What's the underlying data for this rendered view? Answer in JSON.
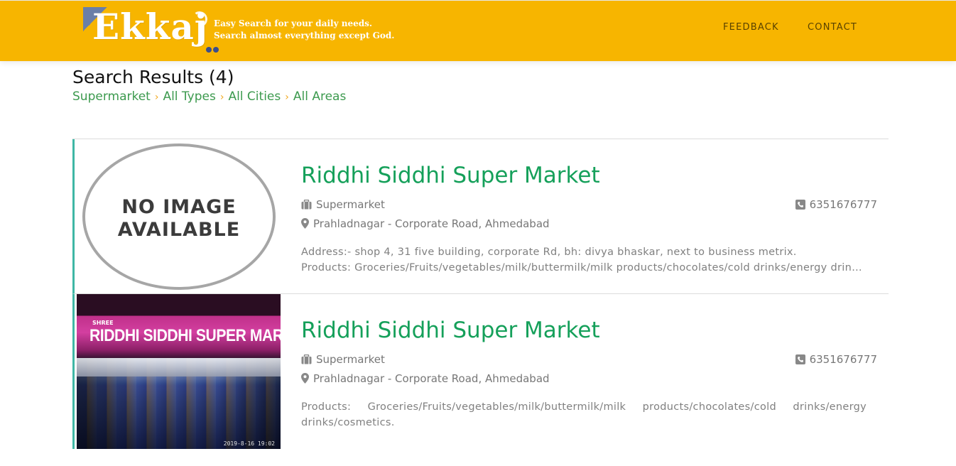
{
  "header": {
    "logo_text": "Ekkaj",
    "tagline_line1": "Easy Search for your daily needs.",
    "tagline_line2": "Search almost everything except God.",
    "nav": [
      {
        "label": "FEEDBACK"
      },
      {
        "label": "CONTACT"
      }
    ],
    "colors": {
      "header_bg": "#f7b500",
      "accent_green": "#15a05a",
      "breadcrumb_green": "#3c9a4e",
      "card_border": "#3fb7a5"
    }
  },
  "results": {
    "title": "Search Results (4)",
    "breadcrumb": [
      "Supermarket",
      "All Types",
      "All Cities",
      "All Areas"
    ]
  },
  "listings": [
    {
      "name": "Riddhi Siddhi Super Market",
      "category": "Supermarket",
      "phone": "6351676777",
      "location": "Prahladnagar - Corporate Road, Ahmedabad",
      "description_line1": "Address:- shop 4, 31 five building, corporate Rd, bh: divya bhaskar, next to business metrix.",
      "description_line2": "Products: Groceries/Fruits/vegetables/milk/buttermilk/milk products/chocolates/cold drinks/energy drinks/cosmetics.",
      "image_placeholder_line1": "NO IMAGE",
      "image_placeholder_line2": "AVAILABLE"
    },
    {
      "name": "Riddhi Siddhi Super Market",
      "category": "Supermarket",
      "phone": "6351676777",
      "location": "Prahladnagar - Corporate Road, Ahmedabad",
      "description": "Products: Groceries/Fruits/vegetables/milk/buttermilk/milk products/chocolates/cold drinks/energy drinks/cosmetics.",
      "photo_sign_small": "SHREE",
      "photo_sign": "RIDDHI SIDDHI SUPER MARKET",
      "photo_timestamp": "2019-8-16 19:02"
    }
  ]
}
